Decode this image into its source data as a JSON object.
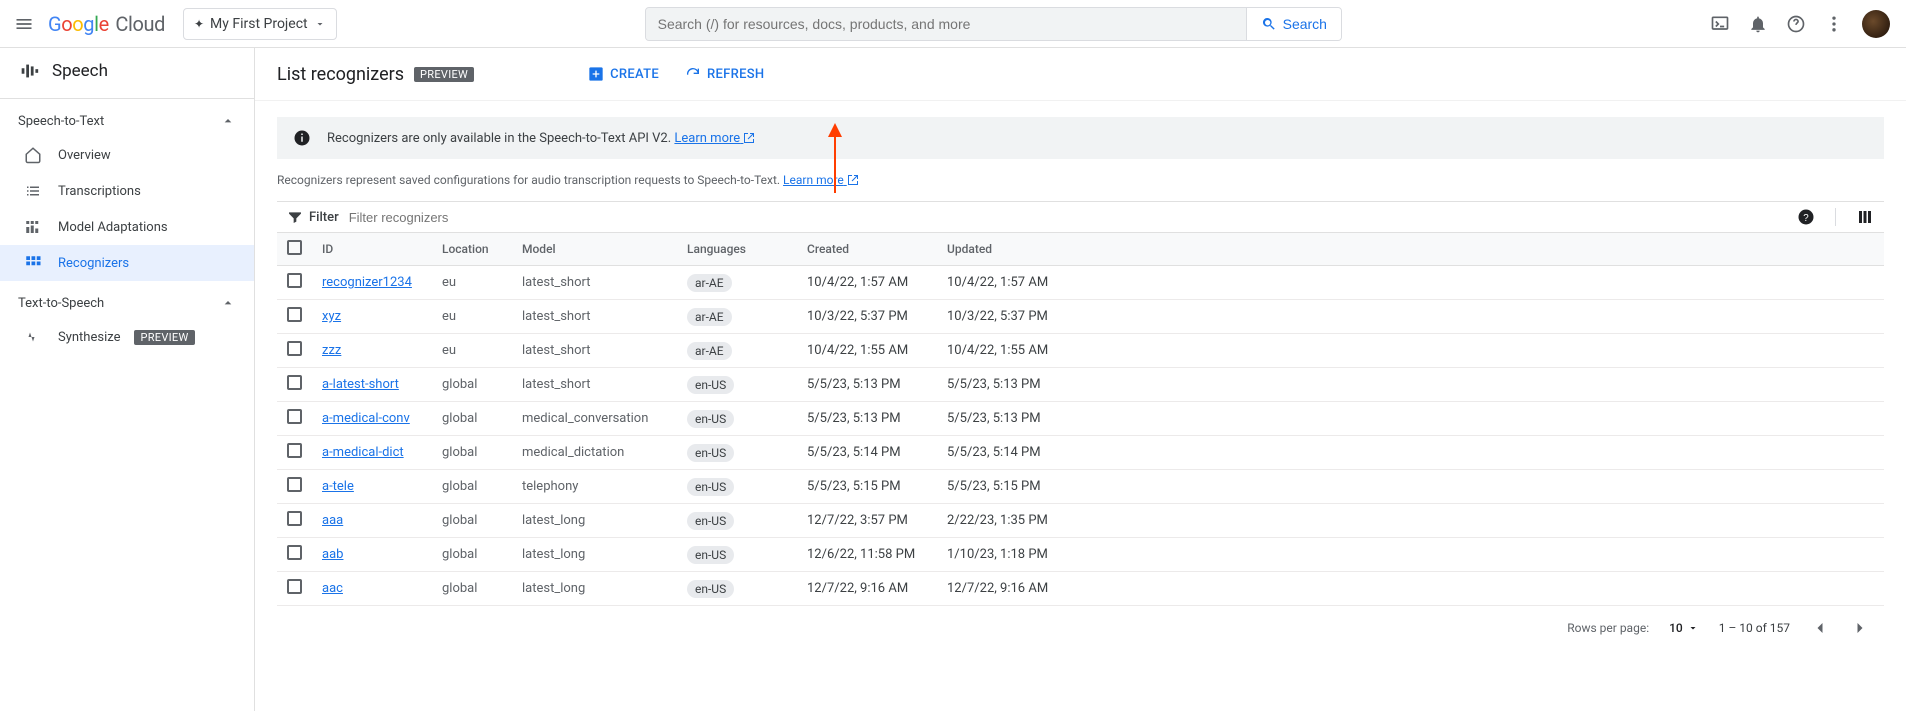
{
  "header": {
    "project": "My First Project",
    "search_placeholder": "Search (/) for resources, docs, products, and more",
    "search_button": "Search"
  },
  "sidebar": {
    "title": "Speech",
    "sections": [
      {
        "label": "Speech-to-Text",
        "items": [
          {
            "label": "Overview"
          },
          {
            "label": "Transcriptions"
          },
          {
            "label": "Model Adaptations"
          },
          {
            "label": "Recognizers",
            "active": true
          }
        ]
      },
      {
        "label": "Text-to-Speech",
        "items": [
          {
            "label": "Synthesize",
            "badge": "PREVIEW"
          }
        ]
      }
    ]
  },
  "page": {
    "title": "List recognizers",
    "title_badge": "PREVIEW",
    "create_label": "CREATE",
    "refresh_label": "REFRESH",
    "banner_text": "Recognizers are only available in the Speech-to-Text API V2.",
    "banner_link": "Learn more",
    "desc_text": "Recognizers represent saved configurations for audio transcription requests to Speech-to-Text.",
    "desc_link": "Learn more",
    "filter_label": "Filter",
    "filter_placeholder": "Filter recognizers"
  },
  "table": {
    "columns": [
      "ID",
      "Location",
      "Model",
      "Languages",
      "Created",
      "Updated"
    ],
    "rows": [
      {
        "id": "recognizer1234",
        "location": "eu",
        "model": "latest_short",
        "lang": "ar-AE",
        "created": "10/4/22, 1:57 AM",
        "updated": "10/4/22, 1:57 AM"
      },
      {
        "id": "xyz",
        "location": "eu",
        "model": "latest_short",
        "lang": "ar-AE",
        "created": "10/3/22, 5:37 PM",
        "updated": "10/3/22, 5:37 PM"
      },
      {
        "id": "zzz",
        "location": "eu",
        "model": "latest_short",
        "lang": "ar-AE",
        "created": "10/4/22, 1:55 AM",
        "updated": "10/4/22, 1:55 AM"
      },
      {
        "id": "a-latest-short",
        "location": "global",
        "model": "latest_short",
        "lang": "en-US",
        "created": "5/5/23, 5:13 PM",
        "updated": "5/5/23, 5:13 PM"
      },
      {
        "id": "a-medical-conv",
        "location": "global",
        "model": "medical_conversation",
        "lang": "en-US",
        "created": "5/5/23, 5:13 PM",
        "updated": "5/5/23, 5:13 PM"
      },
      {
        "id": "a-medical-dict",
        "location": "global",
        "model": "medical_dictation",
        "lang": "en-US",
        "created": "5/5/23, 5:14 PM",
        "updated": "5/5/23, 5:14 PM"
      },
      {
        "id": "a-tele",
        "location": "global",
        "model": "telephony",
        "lang": "en-US",
        "created": "5/5/23, 5:15 PM",
        "updated": "5/5/23, 5:15 PM"
      },
      {
        "id": "aaa",
        "location": "global",
        "model": "latest_long",
        "lang": "en-US",
        "created": "12/7/22, 3:57 PM",
        "updated": "2/22/23, 1:35 PM"
      },
      {
        "id": "aab",
        "location": "global",
        "model": "latest_long",
        "lang": "en-US",
        "created": "12/6/22, 11:58 PM",
        "updated": "1/10/23, 1:18 PM"
      },
      {
        "id": "aac",
        "location": "global",
        "model": "latest_long",
        "lang": "en-US",
        "created": "12/7/22, 9:16 AM",
        "updated": "12/7/22, 9:16 AM"
      }
    ]
  },
  "pager": {
    "rows_per_page_label": "Rows per page:",
    "rows_per_page_value": "10",
    "range": "1 – 10 of 157"
  }
}
